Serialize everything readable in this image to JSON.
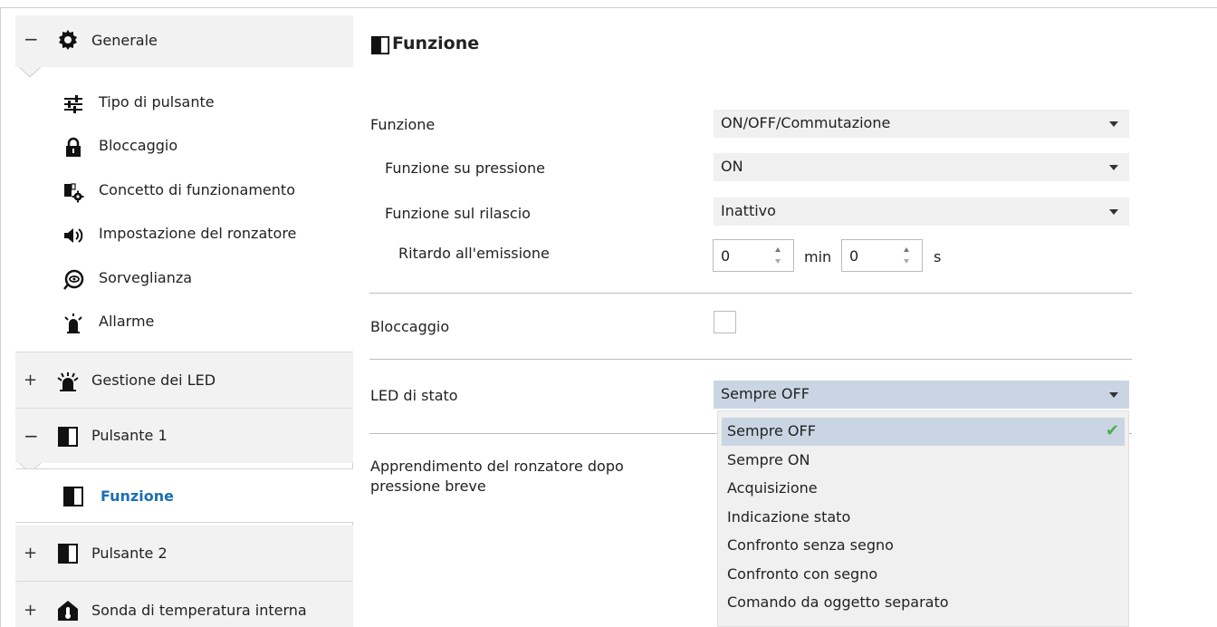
{
  "sidebar": {
    "groups": [
      {
        "toggle": "−",
        "label": "Generale",
        "icon": "gear-icon"
      },
      {
        "toggle": "+",
        "label": "Gestione dei LED",
        "icon": "led-icon"
      },
      {
        "toggle": "−",
        "label": "Pulsante 1",
        "icon": "button-icon"
      },
      {
        "toggle": "+",
        "label": "Pulsante 2",
        "icon": "button-icon"
      },
      {
        "toggle": "+",
        "label": "Sonda di temperatura interna",
        "icon": "thermometer-home-icon"
      }
    ],
    "generale_items": [
      {
        "label": "Tipo di pulsante",
        "icon": "sliders-icon"
      },
      {
        "label": "Bloccaggio",
        "icon": "lock-icon"
      },
      {
        "label": "Concetto di funzionamento",
        "icon": "concept-gear-icon"
      },
      {
        "label": "Impostazione del ronzatore",
        "icon": "speaker-icon"
      },
      {
        "label": "Sorveglianza",
        "icon": "eye-icon"
      },
      {
        "label": "Allarme",
        "icon": "alarm-icon"
      }
    ],
    "pulsante1_items": [
      {
        "label": "Funzione",
        "icon": "button-icon",
        "active": true
      }
    ]
  },
  "main": {
    "title": "Funzione",
    "rows": {
      "funzione": {
        "label": "Funzione",
        "value": "ON/OFF/Commutazione"
      },
      "pressione": {
        "label": "Funzione su pressione",
        "value": "ON"
      },
      "rilascio": {
        "label": "Funzione sul rilascio",
        "value": "Inattivo"
      },
      "ritardo": {
        "label": "Ritardo all'emissione",
        "min_value": "0",
        "min_unit": "min",
        "sec_value": "0",
        "sec_unit": "s"
      },
      "bloccaggio": {
        "label": "Bloccaggio",
        "checked": false
      },
      "led": {
        "label": "LED di stato",
        "value": "Sempre OFF"
      },
      "apprendimento": {
        "label_line1": "Apprendimento del ronzatore dopo",
        "label_line2": "pressione breve"
      }
    },
    "led_options": [
      "Sempre OFF",
      "Sempre ON",
      "Acquisizione",
      "Indicazione stato",
      "Confronto senza segno",
      "Confronto con segno",
      "Comando da oggetto separato"
    ],
    "led_selected_index": 0
  },
  "colors": {
    "accent": "#1a6fb5",
    "selected_bg": "#cad5e3",
    "field_bg": "#f0f0f0",
    "group_bg": "#f2f2f2",
    "check": "#4caf50"
  }
}
